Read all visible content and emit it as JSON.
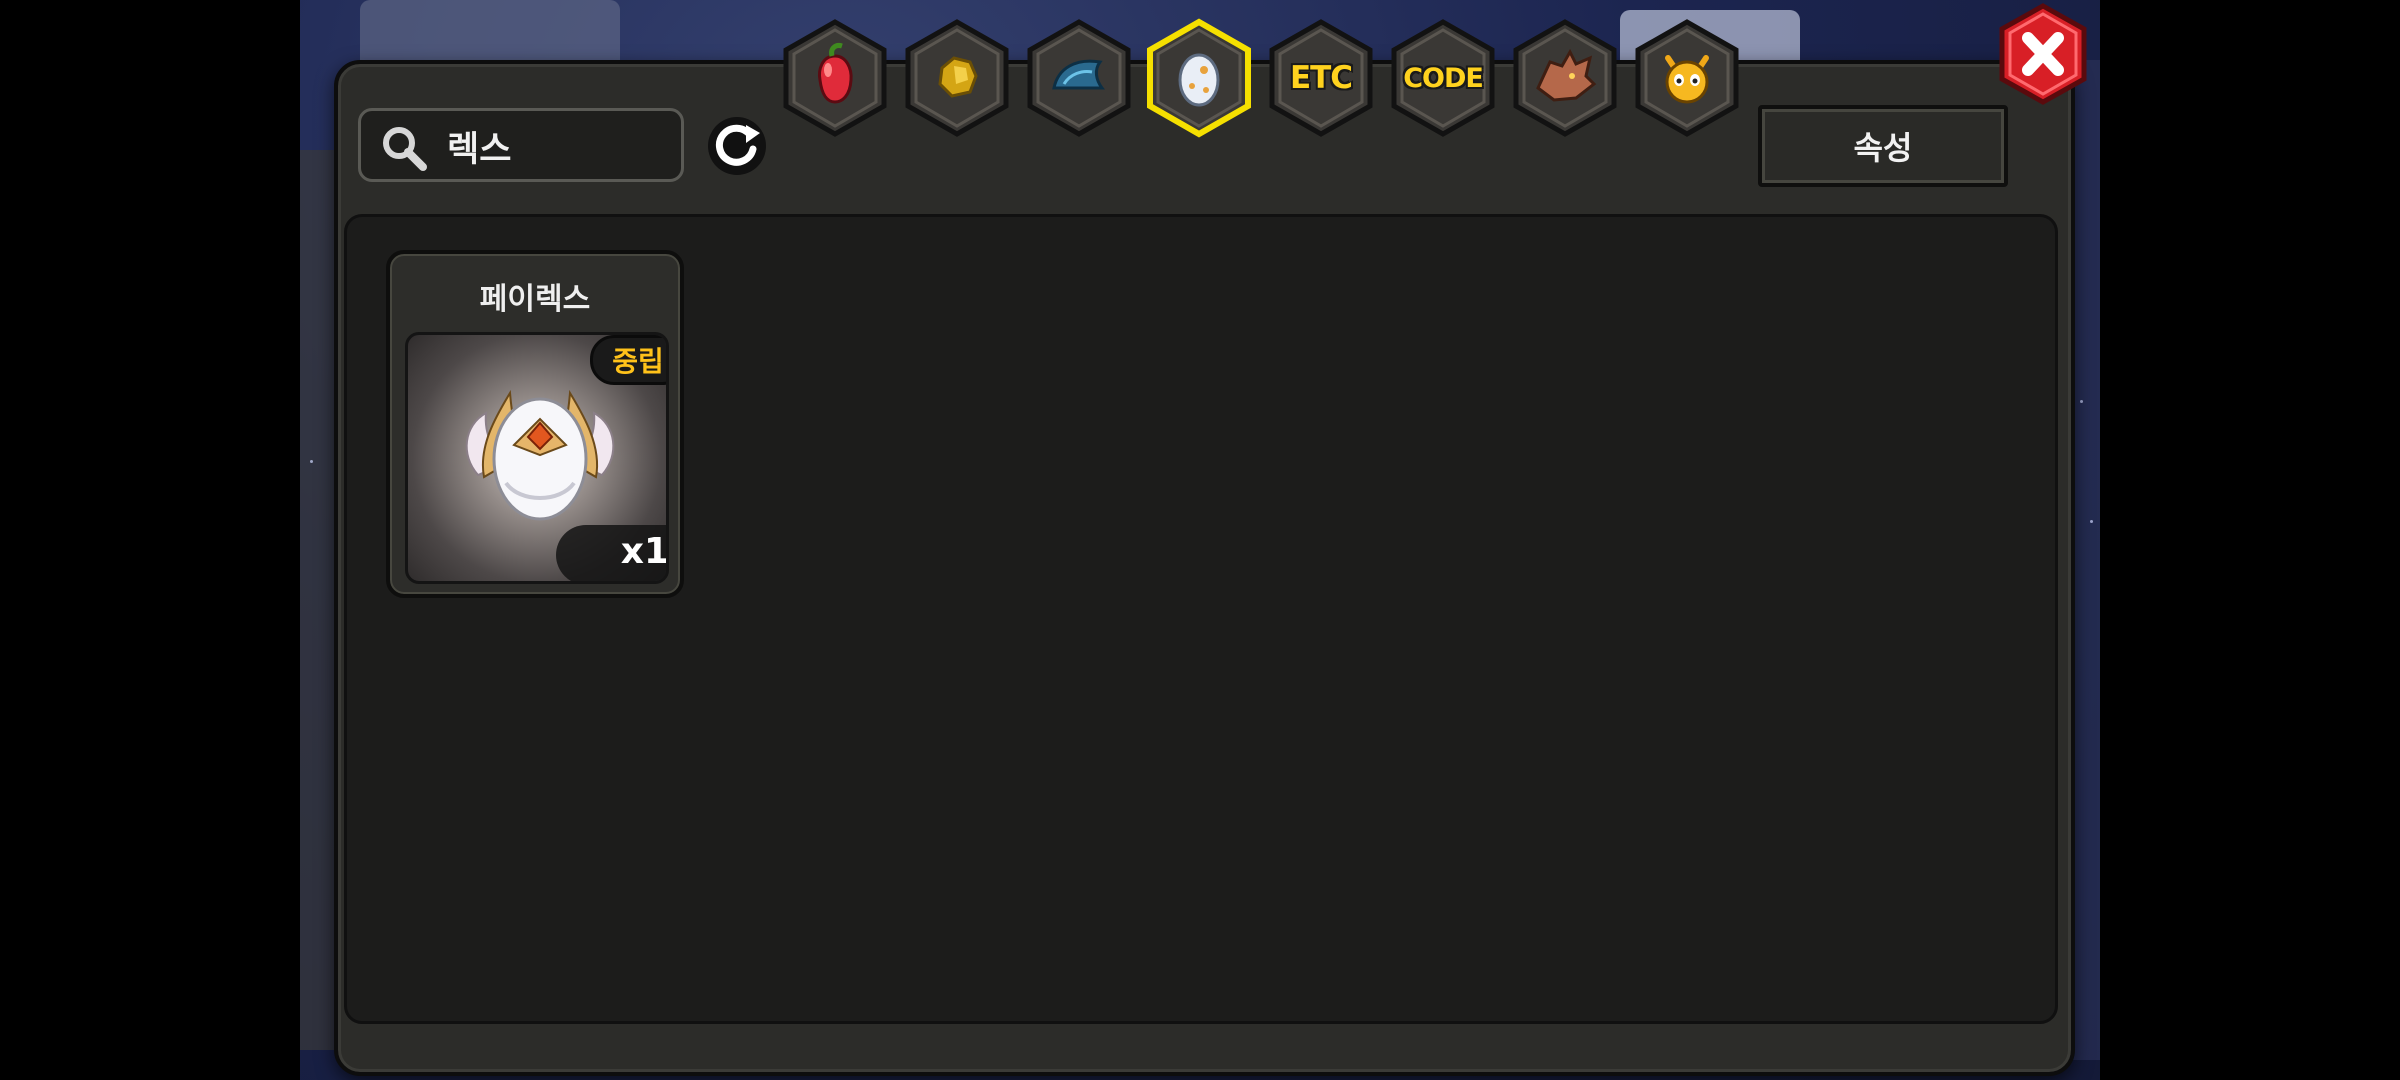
{
  "search": {
    "value": "렉스",
    "icon": "search-icon"
  },
  "refresh": {
    "icon": "refresh-icon"
  },
  "attribute_button": {
    "label": "속성"
  },
  "tabs": [
    {
      "id": "fruit",
      "icon": "fruit-icon",
      "text": "",
      "selected": false
    },
    {
      "id": "gold",
      "icon": "gold-nugget-icon",
      "text": "",
      "selected": false
    },
    {
      "id": "material",
      "icon": "blue-scale-icon",
      "text": "",
      "selected": false
    },
    {
      "id": "egg",
      "icon": "egg-icon",
      "text": "",
      "selected": true
    },
    {
      "id": "etc",
      "icon": "",
      "text": "ETC",
      "selected": false
    },
    {
      "id": "code",
      "icon": "",
      "text": "CODE",
      "selected": false
    },
    {
      "id": "dragon",
      "icon": "dragon-head-icon",
      "text": "",
      "selected": false
    },
    {
      "id": "monster",
      "icon": "horned-face-icon",
      "text": "",
      "selected": false
    }
  ],
  "close_button": {
    "icon": "close-icon"
  },
  "items": [
    {
      "name": "페이렉스",
      "attribute": "중립",
      "count": "x1",
      "image": "winged-egg-icon"
    }
  ],
  "colors": {
    "panel": "#2c2c29",
    "content": "#1c1c1b",
    "tab_selected_border": "#f5e000",
    "tab_text": "#ffd21e",
    "close_red": "#d81f26",
    "attribute_text": "#ffc21a"
  }
}
